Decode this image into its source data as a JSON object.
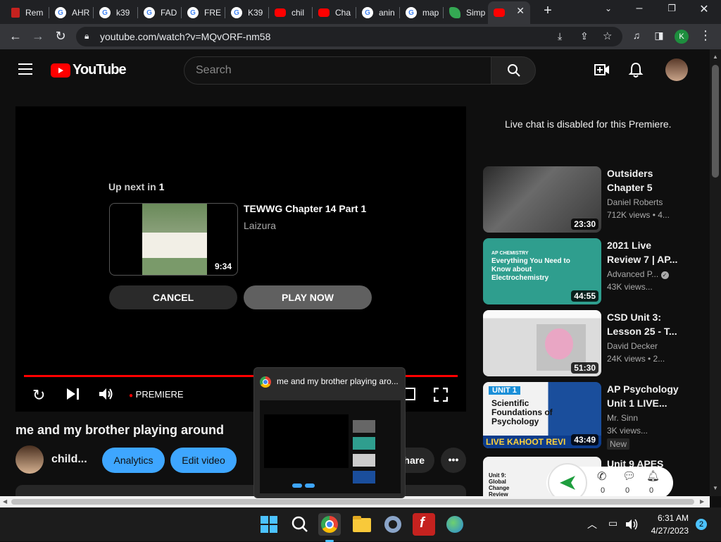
{
  "browser": {
    "tabs": [
      {
        "label": "Rem",
        "icon": "red"
      },
      {
        "label": "AHR",
        "icon": "google"
      },
      {
        "label": "k39",
        "icon": "google"
      },
      {
        "label": "FAD",
        "icon": "google"
      },
      {
        "label": "FRE",
        "icon": "google"
      },
      {
        "label": "K39",
        "icon": "google"
      },
      {
        "label": "chil",
        "icon": "youtube"
      },
      {
        "label": "Cha",
        "icon": "youtube"
      },
      {
        "label": "anin",
        "icon": "google"
      },
      {
        "label": "map",
        "icon": "google"
      },
      {
        "label": "Simp",
        "icon": "leaf"
      },
      {
        "label": "",
        "icon": "youtube"
      }
    ],
    "url": "youtube.com/watch?v=MQvORF-nm58",
    "profile_initial": "K"
  },
  "youtube": {
    "logo_text": "YouTube",
    "search_placeholder": "Search",
    "player": {
      "up_next_prefix": "Up next in",
      "up_next_count": "1",
      "next_title": "TEWWG Chapter 14 Part 1",
      "next_channel": "Laizura",
      "next_duration": "9:34",
      "cancel_label": "CANCEL",
      "play_now_label": "PLAY NOW",
      "premiere_label": "PREMIERE",
      "progress": 1.0
    },
    "video_title": "me and my brother playing around",
    "channel_name": "child...",
    "analytics_label": "Analytics",
    "edit_video_label": "Edit video",
    "share_label": "hare",
    "live_chat_notice": "Live chat is disabled for this Premiere.",
    "recommendations": [
      {
        "title": "Outsiders Chapter 5",
        "channel": "Daniel Roberts",
        "meta": "712K views • 4...",
        "duration": "23:30",
        "thumb_text": ""
      },
      {
        "title": "2021 Live Review 7 | AP...",
        "channel": "Advanced P...",
        "meta": "43K views...",
        "duration": "44:55",
        "thumb_text": "Everything You Need to Know about Electrochemistry",
        "thumb_tag": "AP CHEMISTRY",
        "verified": true
      },
      {
        "title": "CSD Unit 3: Lesson 25 - T...",
        "channel": "David Decker",
        "meta": "24K views • 2...",
        "duration": "51:30",
        "thumb_text": ""
      },
      {
        "title": "AP Psychology Unit 1 LIVE...",
        "channel": "Mr. Sinn",
        "meta": "3K views...",
        "duration": "43:49",
        "thumb_text": "Scientific Foundations of Psychology",
        "thumb_tag": "UNIT 1",
        "thumb_banner": "LIVE KAHOOT REVI",
        "badge": "New"
      },
      {
        "title": "Unit 9 APES",
        "channel": "",
        "meta": "",
        "duration": "",
        "thumb_text": "Unit 9: Global Change Review"
      }
    ]
  },
  "hover_preview": {
    "title": "me and my brother playing aro..."
  },
  "floating_widget": {
    "counts": [
      "0",
      "0",
      "0"
    ]
  },
  "taskbar": {
    "time": "6:31 AM",
    "date": "4/27/2023",
    "notification_count": "2"
  }
}
